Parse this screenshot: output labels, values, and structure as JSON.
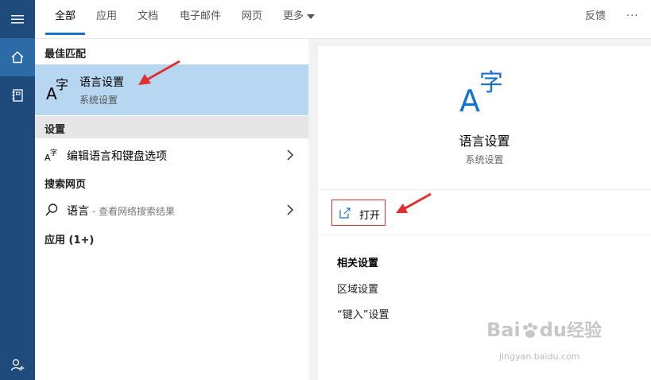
{
  "tabs": [
    {
      "label": "全部"
    },
    {
      "label": "应用"
    },
    {
      "label": "文档"
    },
    {
      "label": "电子邮件"
    },
    {
      "label": "网页"
    },
    {
      "label": "更多"
    }
  ],
  "toolbar": {
    "feedback": "反馈",
    "more": "···"
  },
  "left": {
    "best_match_header": "最佳匹配",
    "best": {
      "title": "语言设置",
      "subtitle": "系统设置"
    },
    "settings_header": "设置",
    "settings_item": "编辑语言和键盘选项",
    "web_header": "搜索网页",
    "web_item": {
      "label": "语言",
      "sub": " - 查看网络搜索结果"
    },
    "apps_header": "应用 (1+)"
  },
  "right": {
    "title": "语言设置",
    "subtitle": "系统设置",
    "open_label": "打开",
    "related_header": "相关设置",
    "related": [
      {
        "label": "区域设置"
      },
      {
        "label": "“键入”设置"
      }
    ]
  },
  "watermark": {
    "brand_a": "Bai",
    "brand_b": "du",
    "brand_c": "经验",
    "url": "jingyan.baidu.com"
  },
  "colors": {
    "rail": "#1e4a7c",
    "accent": "#1572d3",
    "highlight": "#b7d6f1",
    "annotation": "#e03030"
  }
}
